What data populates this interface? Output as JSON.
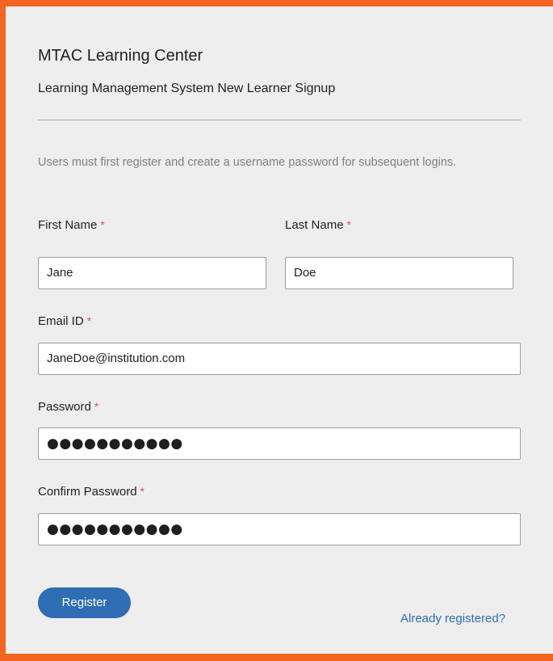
{
  "header": {
    "title": "MTAC Learning Center",
    "subtitle": "Learning Management System New Learner Signup",
    "notice": "Users must first register and create a username password for subsequent logins."
  },
  "form": {
    "required_marker": "*",
    "first_name": {
      "label": "First Name",
      "value": "Jane"
    },
    "last_name": {
      "label": "Last Name",
      "value": "Doe"
    },
    "email": {
      "label": "Email ID",
      "value": "JaneDoe@institution.com"
    },
    "password": {
      "label": "Password",
      "masked_value": "●●●●●●●●●●●"
    },
    "confirm_password": {
      "label": "Confirm Password",
      "masked_value": "●●●●●●●●●●●"
    }
  },
  "actions": {
    "register_label": "Register",
    "already_registered_label": "Already registered?"
  },
  "colors": {
    "border_accent": "#f26522",
    "primary_button": "#2f6db5",
    "link": "#2f6db5",
    "required_marker": "#d9534f",
    "panel_background": "#eeeeee"
  }
}
